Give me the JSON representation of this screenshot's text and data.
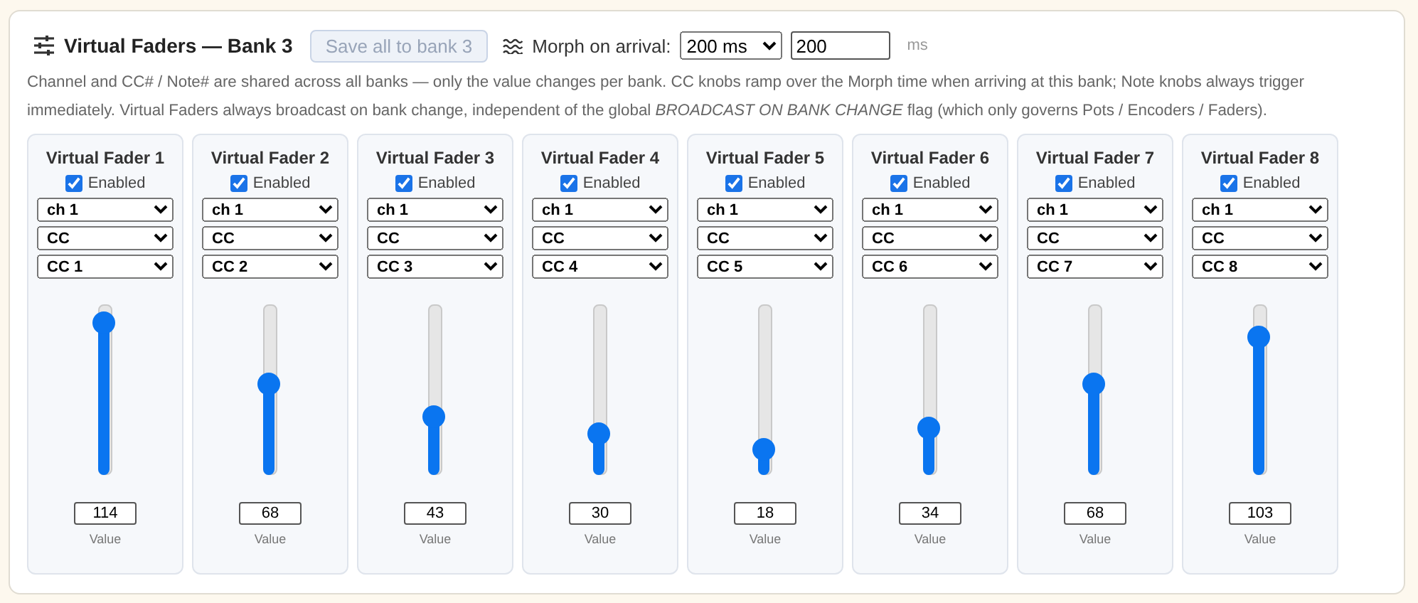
{
  "header": {
    "title": "Virtual Faders — Bank 3",
    "save_button": {
      "label": "Save all to bank 3",
      "disabled": true
    },
    "morph": {
      "label": "Morph on arrival:",
      "select": "200 ms",
      "input": "200",
      "unit": "ms"
    }
  },
  "description": "Channel and CC# / Note# are shared across all banks — only the value changes per bank. CC knobs ramp over the Morph time when arriving at this bank; Note knobs always trigger immediately. Virtual Faders always broadcast on bank change, independent of the global *BROADCAST ON BANK CHANGE* flag (which only governs Pots / Encoders / Faders).",
  "faders": [
    {
      "title": "Virtual Fader 1",
      "enabled_label": "Enabled",
      "enabled": true,
      "channel": "ch 1",
      "type": "CC",
      "number": "CC 1",
      "level": 0.898,
      "value": "114",
      "value_label": "Value"
    },
    {
      "title": "Virtual Fader 2",
      "enabled_label": "Enabled",
      "enabled": true,
      "channel": "ch 1",
      "type": "CC",
      "number": "CC 2",
      "level": 0.535,
      "value": "68",
      "value_label": "Value"
    },
    {
      "title": "Virtual Fader 3",
      "enabled_label": "Enabled",
      "enabled": true,
      "channel": "ch 1",
      "type": "CC",
      "number": "CC 3",
      "level": 0.339,
      "value": "43",
      "value_label": "Value"
    },
    {
      "title": "Virtual Fader 4",
      "enabled_label": "Enabled",
      "enabled": true,
      "channel": "ch 1",
      "type": "CC",
      "number": "CC 4",
      "level": 0.236,
      "value": "30",
      "value_label": "Value"
    },
    {
      "title": "Virtual Fader 5",
      "enabled_label": "Enabled",
      "enabled": true,
      "channel": "ch 1",
      "type": "CC",
      "number": "CC 5",
      "level": 0.142,
      "value": "18",
      "value_label": "Value"
    },
    {
      "title": "Virtual Fader 6",
      "enabled_label": "Enabled",
      "enabled": true,
      "channel": "ch 1",
      "type": "CC",
      "number": "CC 6",
      "level": 0.268,
      "value": "34",
      "value_label": "Value"
    },
    {
      "title": "Virtual Fader 7",
      "enabled_label": "Enabled",
      "enabled": true,
      "channel": "ch 1",
      "type": "CC",
      "number": "CC 7",
      "level": 0.535,
      "value": "68",
      "value_label": "Value"
    },
    {
      "title": "Virtual Fader 8",
      "enabled_label": "Enabled",
      "enabled": true,
      "channel": "ch 1",
      "type": "CC",
      "number": "CC 8",
      "level": 0.811,
      "value": "103",
      "value_label": "Value"
    }
  ]
}
